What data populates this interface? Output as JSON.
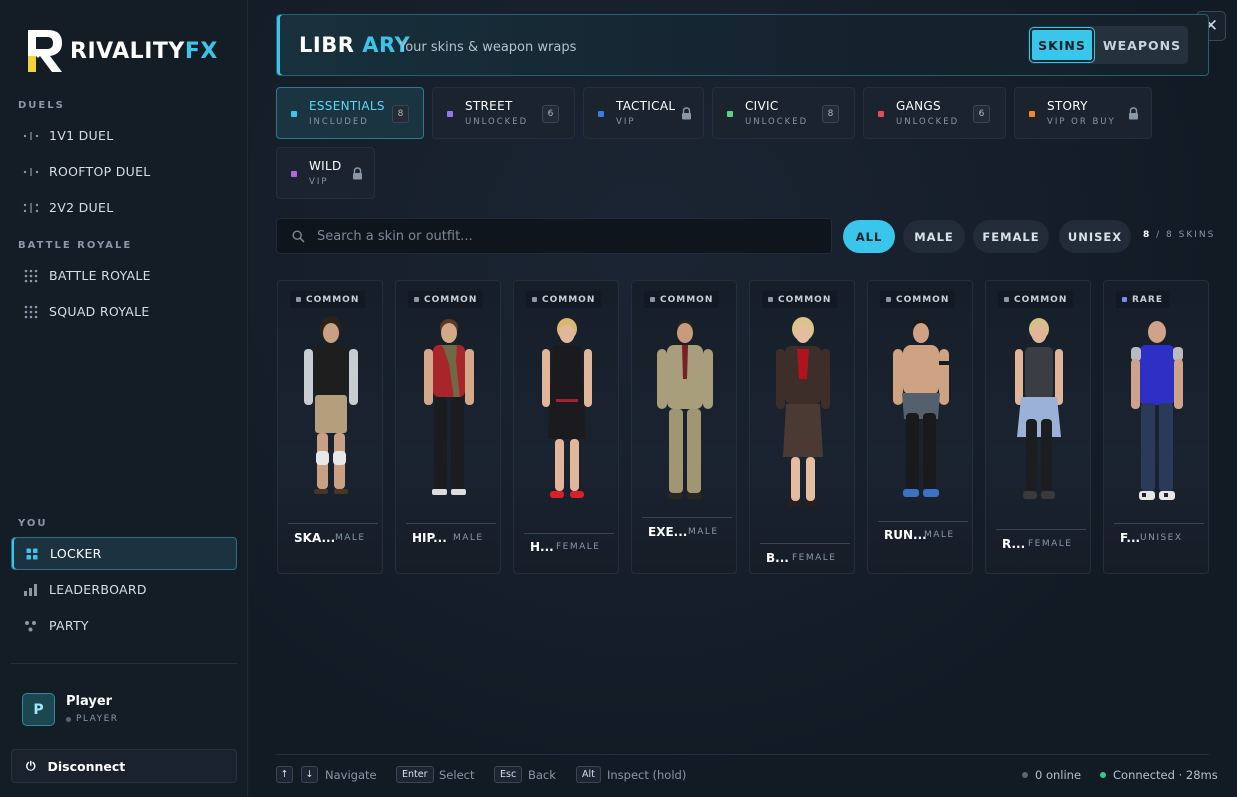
{
  "brand": {
    "name_main": "RIVALITY",
    "name_accent": "FX"
  },
  "sidebar": {
    "section_duels": "DUELS",
    "duels": [
      {
        "label": "1V1 DUEL"
      },
      {
        "label": "ROOFTOP DUEL"
      },
      {
        "label": "2V2 DUEL"
      }
    ],
    "section_battle": "BATTLE ROYALE",
    "battle": [
      {
        "label": "BATTLE ROYALE"
      },
      {
        "label": "SQUAD ROYALE"
      }
    ],
    "section_you": "YOU",
    "you": [
      {
        "label": "LOCKER",
        "active": true
      },
      {
        "label": "LEADERBOARD"
      },
      {
        "label": "PARTY"
      }
    ],
    "player": {
      "initial": "P",
      "name": "Player",
      "role": "PLAYER"
    },
    "disconnect_label": "Disconnect"
  },
  "header": {
    "title_main": "LIBR ",
    "title_accent": "ARY",
    "subtitle": "Your skins & weapon wraps",
    "tabs": {
      "skins": "SKINS",
      "weapons": "WEAPONS"
    },
    "close": "✕"
  },
  "categories": [
    {
      "name": "ESSENTIALS",
      "sub": "INCLUDED",
      "count": "8",
      "color": "#39c6ea"
    },
    {
      "name": "STREET",
      "sub": "UNLOCKED",
      "count": "6",
      "color": "#8f7ce6"
    },
    {
      "name": "TACTICAL",
      "sub": "VIP",
      "color": "#3a7be0"
    },
    {
      "name": "CIVIC",
      "sub": "UNLOCKED",
      "count": "8",
      "color": "#5fcf8e"
    },
    {
      "name": "GANGS",
      "sub": "UNLOCKED",
      "count": "6",
      "color": "#e0505b"
    },
    {
      "name": "STORY",
      "sub": "VIP OR BUY",
      "color": "#f08a30"
    },
    {
      "name": "WILD",
      "sub": "VIP",
      "color": "#b462e6"
    }
  ],
  "search": {
    "placeholder": "Search a skin or outfit..."
  },
  "filters": {
    "all": "ALL",
    "male": "MALE",
    "female": "FEMALE",
    "unisex": "UNISEX"
  },
  "skin_count": {
    "shown": "8",
    "rest": " / 8 SKINS"
  },
  "skins": [
    {
      "rarity": "COMMON",
      "name": "SKA...",
      "gender": "MALE",
      "rarity_color": "#8a97a6"
    },
    {
      "rarity": "COMMON",
      "name": "HIP...",
      "gender": "MALE",
      "rarity_color": "#8a97a6"
    },
    {
      "rarity": "COMMON",
      "name": "H...",
      "gender": "FEMALE",
      "rarity_color": "#8a97a6"
    },
    {
      "rarity": "COMMON",
      "name": "EXE...",
      "gender": "MALE",
      "rarity_color": "#8a97a6"
    },
    {
      "rarity": "COMMON",
      "name": "B...",
      "gender": "FEMALE",
      "rarity_color": "#8a97a6"
    },
    {
      "rarity": "COMMON",
      "name": "RUN...",
      "gender": "MALE",
      "rarity_color": "#8a97a6"
    },
    {
      "rarity": "COMMON",
      "name": "R...",
      "gender": "FEMALE",
      "rarity_color": "#8a97a6"
    },
    {
      "rarity": "RARE",
      "name": "F...",
      "gender": "UNISEX",
      "rarity_color": "#7b8cf0"
    }
  ],
  "footer": {
    "key_up": "↑",
    "key_down": "↓",
    "navigate": "Navigate",
    "key_enter": "Enter",
    "select": "Select",
    "key_esc": "Esc",
    "back": "Back",
    "key_alt": "Alt",
    "inspect": "Inspect (hold)",
    "online": "0 online",
    "connected": "Connected · 28ms"
  }
}
